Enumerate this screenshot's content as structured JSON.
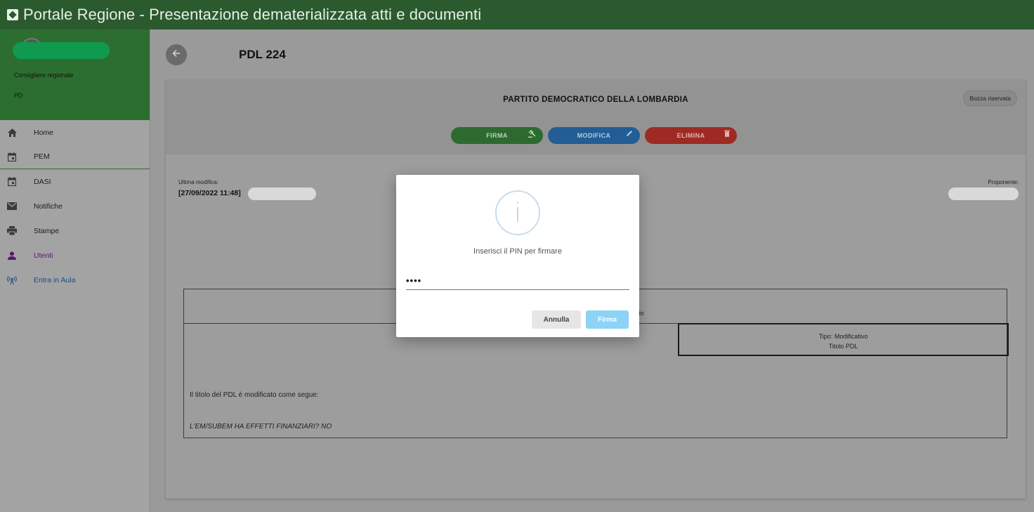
{
  "app": {
    "title": "Portale Regione - Presentazione dematerializzata atti e documenti"
  },
  "user": {
    "role": "Consigliere regionale",
    "group": "PD"
  },
  "nav": [
    {
      "label": "Home",
      "icon": "home-icon"
    },
    {
      "label": "PEM",
      "icon": "calendar-icon"
    },
    {
      "label": "DASI",
      "icon": "calendar-icon"
    },
    {
      "label": "Notifiche",
      "icon": "mail-icon"
    },
    {
      "label": "Stampe",
      "icon": "printer-icon"
    },
    {
      "label": "Utenti",
      "icon": "user-icon"
    },
    {
      "label": "Entra in Aula",
      "icon": "antenna-icon"
    }
  ],
  "page": {
    "title": "PDL 224"
  },
  "card": {
    "party": "PARTITO DEMOCRATICO DELLA LOMBARDIA",
    "badge": "Bozza riservata",
    "actions": {
      "sign": "FIRMA",
      "edit": "MODIFICA",
      "delete": "ELIMINA"
    },
    "last_modified_label": "Ultima modifica:",
    "last_modified_value": "[27/09/2022 11:48]",
    "proposer_label": "Proponente:",
    "doc_fragment": "ncio",
    "type_line": "Tipo: Modificativo",
    "title_line": "Titolo PDL",
    "body_text": "Il titolo del PDL è modificato come segue:",
    "financial_text": "L'EM/SUBEM HA EFFETTI FINANZIARI? NO"
  },
  "modal": {
    "icon": "info-icon",
    "message": "Inserisci il PIN per firmare",
    "pin_value": "••••",
    "cancel_label": "Annulla",
    "confirm_label": "Firma"
  }
}
